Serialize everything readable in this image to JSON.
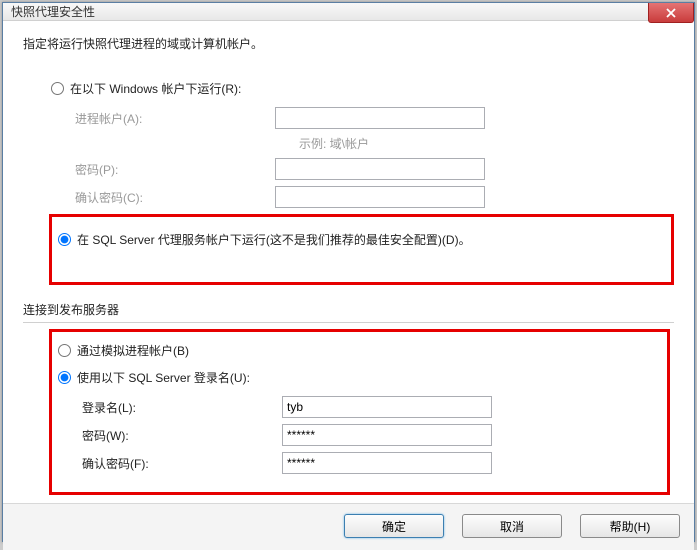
{
  "window": {
    "title": "快照代理安全性"
  },
  "instruction": "指定将运行快照代理进程的域或计算机帐户。",
  "run_under": {
    "windows_radio": "在以下 Windows 帐户下运行(R):",
    "process_account_label": "进程帐户(A):",
    "example": "示例: 域\\帐户",
    "password_label": "密码(P):",
    "confirm_label": "确认密码(C):",
    "sql_agent_radio": "在 SQL Server 代理服务帐户下运行(这不是我们推荐的最佳安全配置)(D)。"
  },
  "connect": {
    "section_title": "连接到发布服务器",
    "impersonate_radio": "通过模拟进程帐户(B)",
    "sql_login_radio": "使用以下 SQL Server 登录名(U):",
    "login_label": "登录名(L):",
    "login_value": "tyb",
    "password_label": "密码(W):",
    "password_value": "******",
    "confirm_label": "确认密码(F):",
    "confirm_value": "******"
  },
  "buttons": {
    "ok": "确定",
    "cancel": "取消",
    "help": "帮助(H)"
  }
}
